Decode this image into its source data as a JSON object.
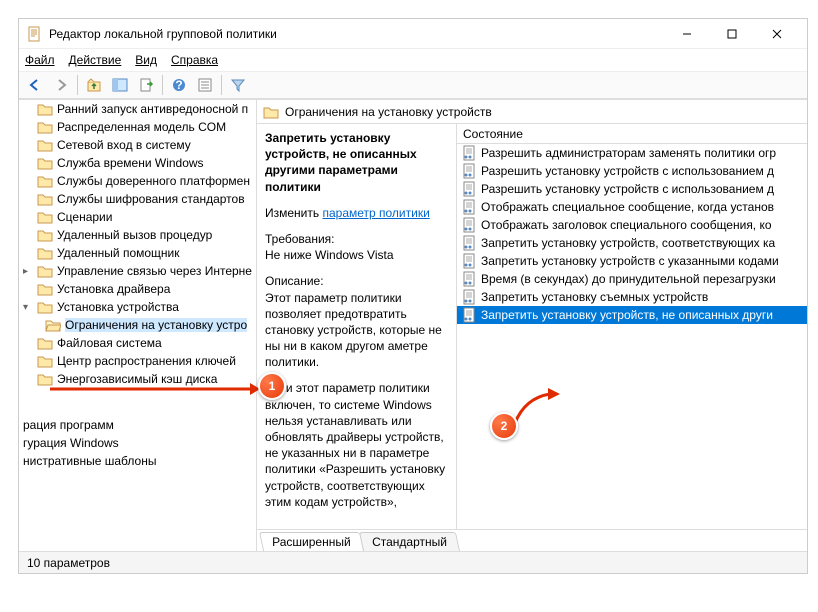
{
  "titlebar": {
    "title": "Редактор локальной групповой политики"
  },
  "menu": {
    "file": "Файл",
    "action": "Действие",
    "view": "Вид",
    "help": "Справка"
  },
  "tree": {
    "items": [
      "Ранний запуск антивредоносной п",
      "Распределенная модель COM",
      "Сетевой вход в систему",
      "Служба времени Windows",
      "Службы доверенного платформен",
      "Службы шифрования стандартов",
      "Сценарии",
      "Удаленный вызов процедур",
      "Удаленный помощник",
      "Управление связью через Интерне",
      "Установка драйвера",
      "Установка устройства",
      "Ограничения на установку устро",
      "Файловая система",
      "Центр распространения ключей",
      "Энергозависимый кэш диска"
    ],
    "orphans": [
      "рация программ",
      "гурация Windows",
      "нистративные шаблоны"
    ]
  },
  "path_header": "Ограничения на установку устройств",
  "description": {
    "setting_name": "Запретить установку устройств, не описанных другими параметрами политики",
    "edit_prefix": "Изменить ",
    "edit_link": "параметр политики",
    "req_label": "Требования:",
    "req_value": "Не ниже Windows Vista",
    "desc_label": "Описание:",
    "desc_p1": "Этот параметр политики позволяет предотвратить становку устройств, которые не ны ни в каком другом аметре политики.",
    "desc_p2": "Если этот параметр политики включен, то системе Windows нельзя устанавливать или обновлять драйверы устройств, не указанных ни в параметре политики «Разрешить установку устройств, соответствующих этим кодам устройств»,"
  },
  "list": {
    "header": "Состояние",
    "items": [
      "Разрешить администраторам заменять политики огр",
      "Разрешить установку устройств с использованием д",
      "Разрешить установку устройств с использованием д",
      "Отображать специальное сообщение, когда установ",
      "Отображать заголовок специального сообщения, ко",
      "Запретить установку устройств, соответствующих ка",
      "Запретить установку устройств с указанными кодами",
      "Время (в секундах) до принудительной перезагрузки",
      "Запретить установку съемных устройств",
      "Запретить установку устройств, не описанных други"
    ],
    "selected": 9
  },
  "tabs": {
    "extended": "Расширенный",
    "standard": "Стандартный"
  },
  "statusbar": "10 параметров",
  "callouts": {
    "one": "1",
    "two": "2"
  }
}
